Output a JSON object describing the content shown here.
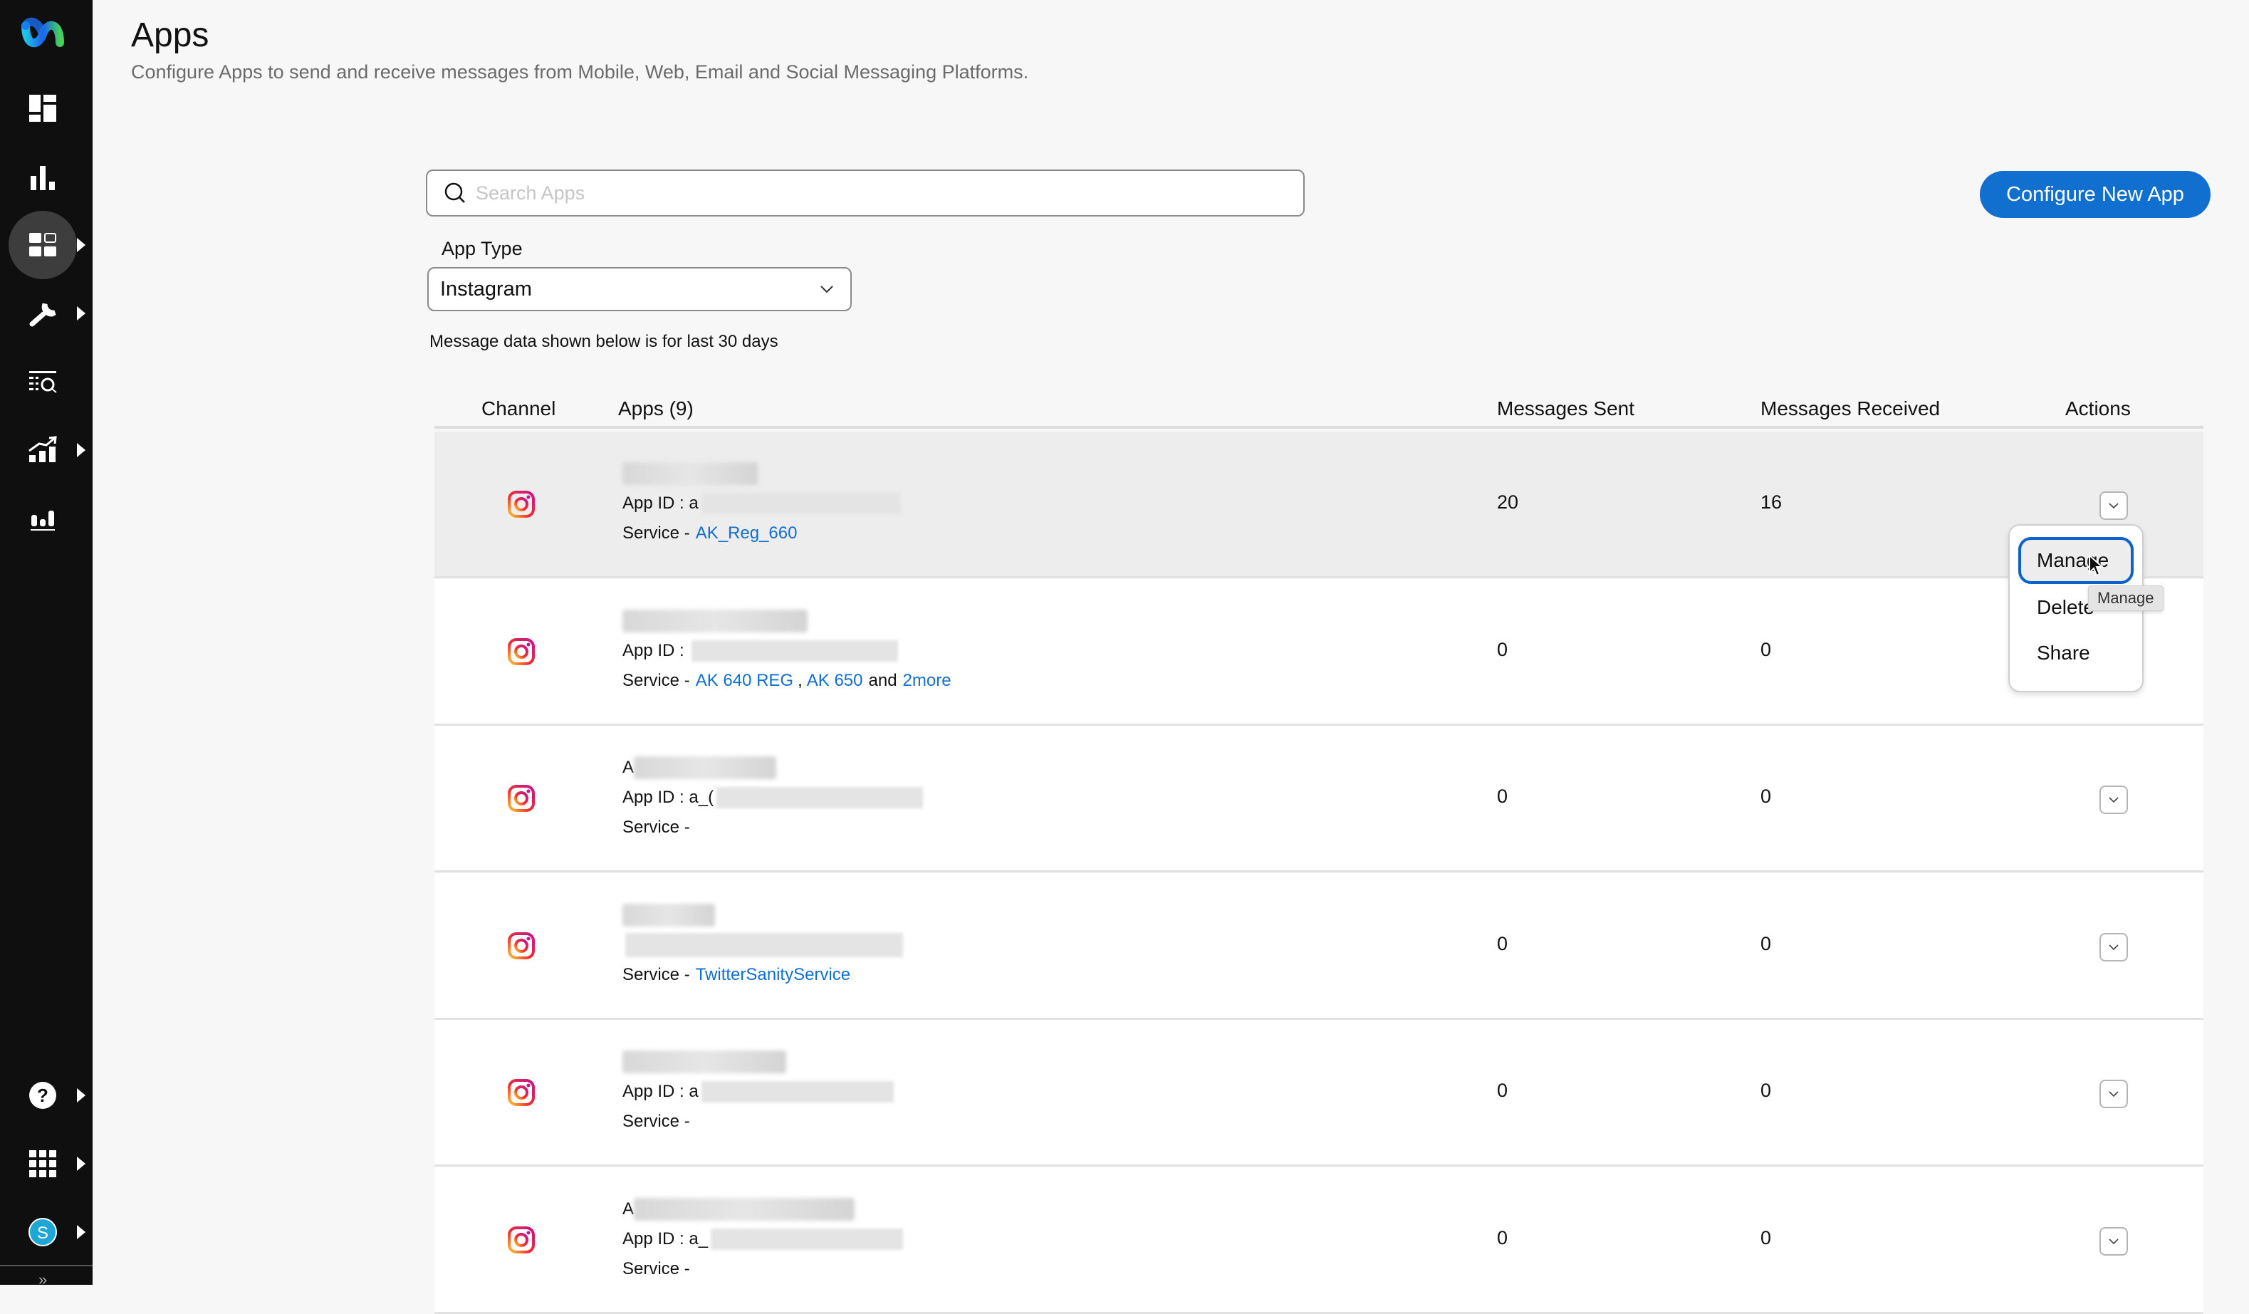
{
  "sidebar": {
    "logo": "webex-logo-icon",
    "items": [
      {
        "icon": "dashboard-icon",
        "has_submenu": false,
        "active": false
      },
      {
        "icon": "bar-chart-icon",
        "has_submenu": false,
        "active": false
      },
      {
        "icon": "apps-grid-icon",
        "has_submenu": true,
        "active": true
      },
      {
        "icon": "wrench-icon",
        "has_submenu": true,
        "active": false
      },
      {
        "icon": "list-search-icon",
        "has_submenu": false,
        "active": false
      },
      {
        "icon": "trend-chart-icon",
        "has_submenu": true,
        "active": false
      },
      {
        "icon": "analytics-icon",
        "has_submenu": false,
        "active": false
      }
    ],
    "bottom_items": [
      {
        "icon": "help-icon",
        "has_submenu": true
      },
      {
        "icon": "app-launcher-icon",
        "has_submenu": true
      },
      {
        "icon": "user-avatar-icon",
        "label": "S",
        "has_submenu": true
      }
    ],
    "expand_label": "»"
  },
  "header": {
    "title": "Apps",
    "description": "Configure Apps to send and receive messages from Mobile, Web, Email and Social Messaging Platforms."
  },
  "search": {
    "placeholder": "Search Apps",
    "value": ""
  },
  "configure_button": "Configure New App",
  "app_type": {
    "label": "App Type",
    "selected": "Instagram"
  },
  "note": "Message data shown below is for last 30 days",
  "table": {
    "columns": {
      "channel": "Channel",
      "apps": "Apps (9)",
      "sent": "Messages Sent",
      "received": "Messages Received",
      "actions": "Actions"
    },
    "rows": [
      {
        "channel": "instagram",
        "app_id_label": "App ID :",
        "app_id_prefix": "a",
        "service_label": "Service -",
        "services": [
          "AK_Reg_660"
        ],
        "more": "",
        "sent": "20",
        "received": "16",
        "hovered": true
      },
      {
        "channel": "instagram",
        "app_id_label": "App ID :",
        "app_id_prefix": "",
        "service_label": "Service -",
        "services": [
          "AK 640 REG",
          "AK 650"
        ],
        "more_connector": "and",
        "more": "2more",
        "sent": "0",
        "received": "0"
      },
      {
        "channel": "instagram",
        "name_prefix": "A",
        "app_id_label": "App ID :",
        "app_id_prefix": "a_(",
        "service_label": "Service -",
        "services": [],
        "sent": "0",
        "received": "0"
      },
      {
        "channel": "instagram",
        "app_id_label": "",
        "app_id_prefix": "",
        "service_label": "Service -",
        "services": [
          "TwitterSanityService"
        ],
        "sent": "0",
        "received": "0"
      },
      {
        "channel": "instagram",
        "app_id_label": "App ID :",
        "app_id_prefix": "a",
        "service_label": "Service -",
        "services": [],
        "sent": "0",
        "received": "0"
      },
      {
        "channel": "instagram",
        "name_prefix": "A",
        "app_id_label": "App ID :",
        "app_id_prefix": "a_",
        "service_label": "Service -",
        "services": [],
        "sent": "0",
        "received": "0"
      }
    ]
  },
  "actions_menu": {
    "items": [
      "Manage",
      "Delete",
      "Share"
    ],
    "focused": "Manage",
    "tooltip": "Manage"
  },
  "colors": {
    "accent": "#1170cf",
    "sidebar_bg": "#0f0f0f",
    "link": "#1170cf"
  }
}
